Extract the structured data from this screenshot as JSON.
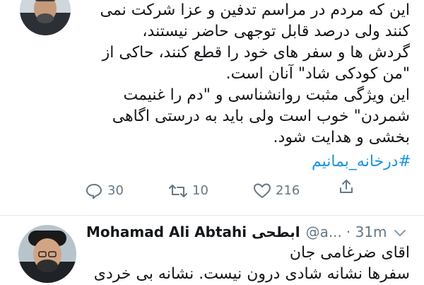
{
  "tweet": {
    "lines": [
      "این که مردم در مراسم تدفین و عزا شرکت نمی",
      "کنند ولی درصد قابل توجهی حاضر نیستند،",
      "گردش ها و سفر های خود را قطع کنند، حاکی از",
      "\"من کودکی شاد\" آنان است.",
      "این ویژگی مثبت روانشناسی و \"دم را غنیمت",
      "شمردن\" خوب است ولی باید به درستی اگاهی",
      "بخشی و هدایت شود."
    ],
    "hashtag": "#درخانه_بمانیم",
    "actions": {
      "reply_count": "30",
      "retweet_count": "10",
      "like_count": "216"
    }
  },
  "reply": {
    "name": "Mohamad Ali Abtahi ابطحی",
    "handle": "@a...",
    "time": "· 31m",
    "lines": [
      "اقای ضرغامی جان",
      "سفرها نشانه شادی درون نیست. نشانه بی خردی"
    ]
  },
  "colors": {
    "text": "#14171a",
    "secondary": "#657786",
    "link": "#1b95e0",
    "divider": "#e6ecf0"
  },
  "icons": [
    "reply-icon",
    "retweet-icon",
    "like-icon",
    "share-icon",
    "chevron-down-icon"
  ]
}
